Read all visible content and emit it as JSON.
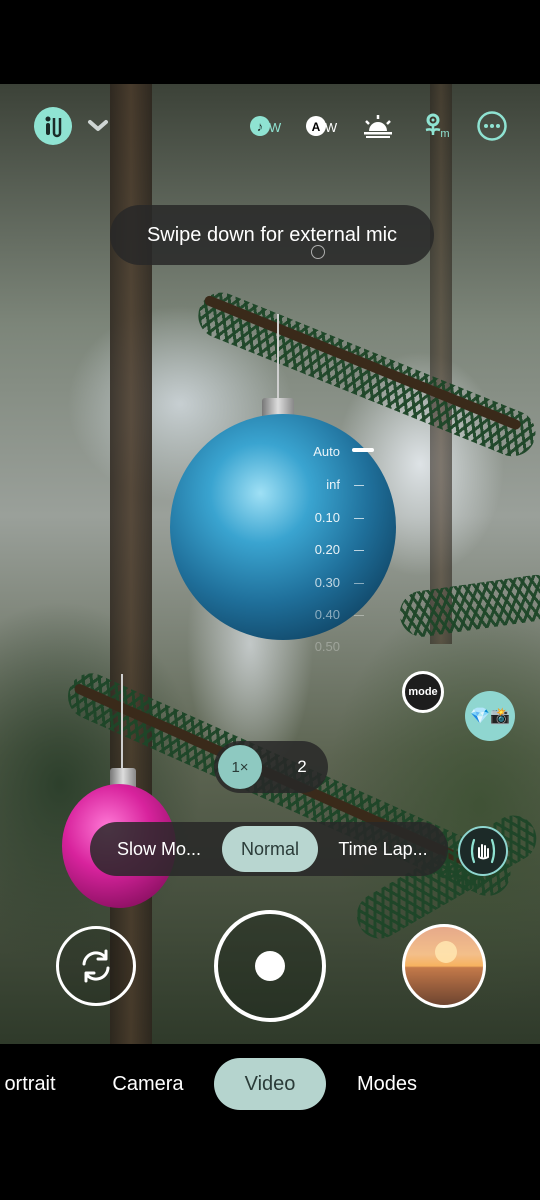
{
  "top_bar": {
    "filter_label": "Filter",
    "icons": [
      "filter-icon",
      "chevron-down-icon",
      "white-balance-icon",
      "auto-white-balance-icon",
      "exposure-icon",
      "macro-icon",
      "more-icon"
    ],
    "awb_text": "AW",
    "wb_text": "W"
  },
  "toast": {
    "text": "Swipe down for external mic"
  },
  "focus_scale": {
    "labels": [
      "Auto",
      "inf",
      "0.10",
      "0.20",
      "0.30",
      "0.40",
      "0.50"
    ],
    "selected": "Auto"
  },
  "badges": {
    "mode": "mode",
    "hd": "💎📸"
  },
  "zoom": {
    "options": [
      "1×",
      "2"
    ],
    "selected": "1×"
  },
  "speed": {
    "options": [
      "Slow Mo...",
      "Normal",
      "Time Lap..."
    ],
    "selected": "Normal"
  },
  "camera_modes": {
    "items": [
      "ortrait",
      "Camera",
      "Video",
      "Modes"
    ],
    "selected": "Video"
  },
  "colors": {
    "accent": "#8fe3d2",
    "selected_pill": "#b5d4ce",
    "pill_bg": "#282828"
  }
}
